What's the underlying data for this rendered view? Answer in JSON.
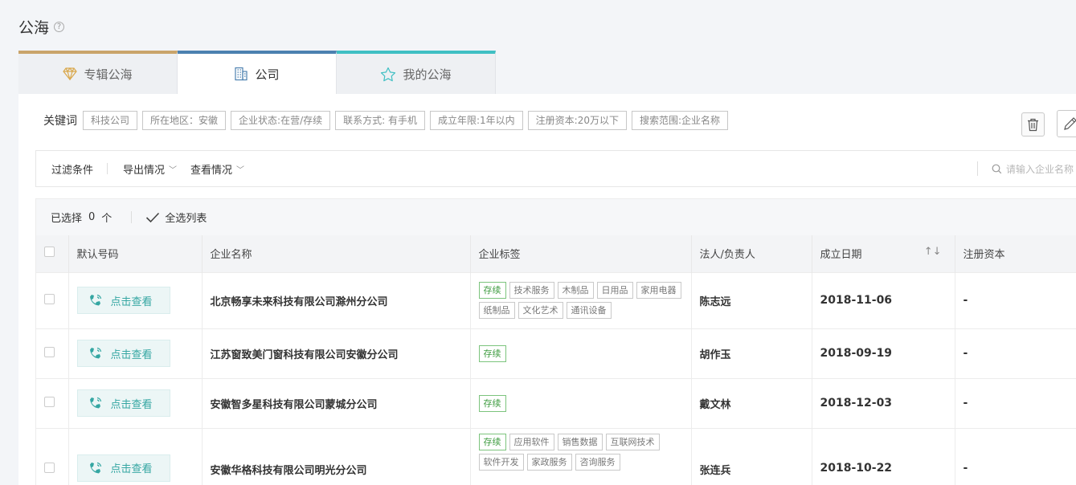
{
  "page": {
    "title": "公海",
    "help_icon": "?"
  },
  "tabs": [
    {
      "label": "专辑公海",
      "icon": "diamond-icon",
      "color": "#c9a46a"
    },
    {
      "label": "公司",
      "icon": "building-icon",
      "color": "#4c81b0"
    },
    {
      "label": "我的公海",
      "icon": "star-icon",
      "color": "#3fbfc3"
    }
  ],
  "keywords": {
    "label": "关键词",
    "chips": [
      "科技公司",
      "所在地区：安徽",
      "企业状态:在营/存续",
      "联系方式: 有手机",
      "成立年限:1年以内",
      "注册资本:20万以下",
      "搜索范围:企业名称"
    ]
  },
  "filters": {
    "items": [
      "过滤条件",
      "导出情况",
      "查看情况"
    ],
    "search_placeholder": "请输入企业名称"
  },
  "selection": {
    "label": "已选择",
    "count": "0",
    "unit": "个",
    "select_all": "全选列表"
  },
  "table": {
    "headers": [
      "默认号码",
      "企业名称",
      "企业标签",
      "法人/负责人",
      "成立日期",
      "注册资本"
    ],
    "call_label": "点击查看",
    "rows": [
      {
        "name": "北京畅享未来科技有限公司滁州分公司",
        "tags": [
          "存续",
          "技术服务",
          "木制品",
          "日用品",
          "家用电器",
          "纸制品",
          "文化艺术",
          "通讯设备"
        ],
        "person": "陈志远",
        "date": "2018-11-06",
        "capital": "-"
      },
      {
        "name": "江苏窗致美门窗科技有限公司安徽分公司",
        "tags": [
          "存续"
        ],
        "person": "胡作玉",
        "date": "2018-09-19",
        "capital": "-"
      },
      {
        "name": "安徽智多星科技有限公司蒙城分公司",
        "tags": [
          "存续"
        ],
        "person": "戴文林",
        "date": "2018-12-03",
        "capital": "-"
      },
      {
        "name": "安徽华格科技有限公司明光分公司",
        "tags": [
          "存续",
          "应用软件",
          "销售数据",
          "互联网技术",
          "软件开发",
          "家政服务",
          "咨询服务"
        ],
        "person": "张连兵",
        "date": "2018-10-22",
        "capital": "-"
      }
    ]
  },
  "colors": {
    "accent": "#34a6a2",
    "status_green": "#3d9b3f"
  }
}
